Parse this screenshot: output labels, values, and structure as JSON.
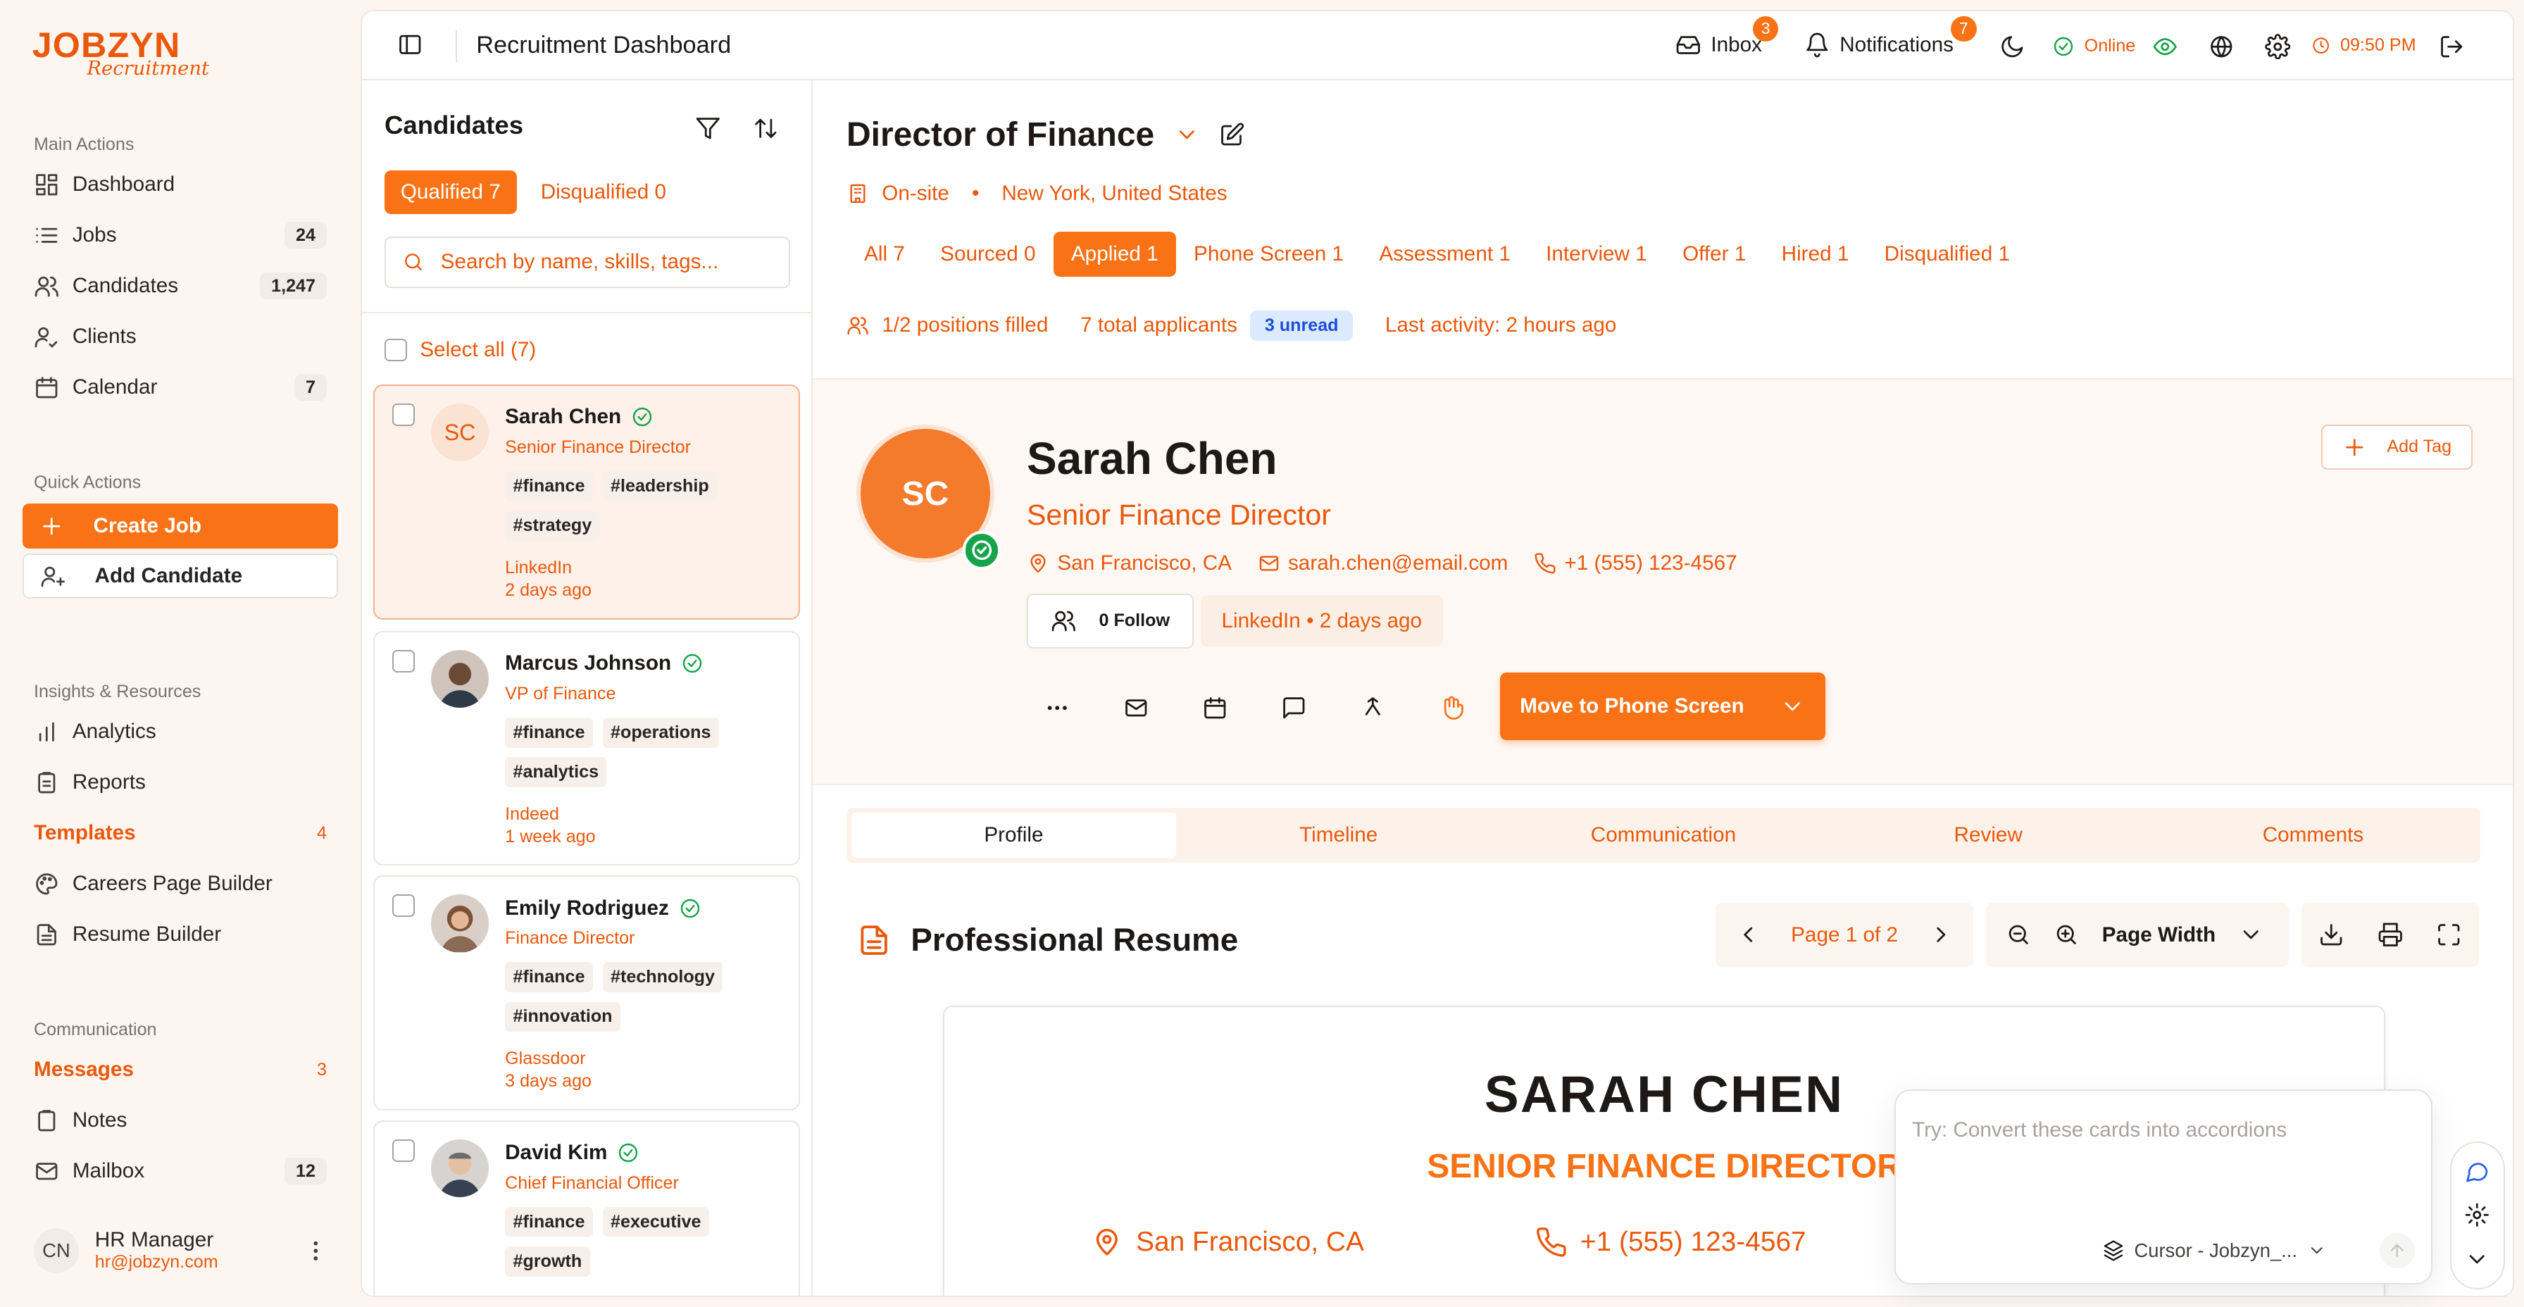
{
  "brand": {
    "name": "JOBZYN",
    "sub": "Recruitment"
  },
  "sidebar": {
    "main_title": "Main Actions",
    "main_items": [
      {
        "label": "Dashboard",
        "badge": "",
        "icon": "grid-icon"
      },
      {
        "label": "Jobs",
        "badge": "24",
        "icon": "list-icon"
      },
      {
        "label": "Candidates",
        "badge": "1,247",
        "icon": "users-icon"
      },
      {
        "label": "Clients",
        "badge": "",
        "icon": "user-check-icon"
      },
      {
        "label": "Calendar",
        "badge": "7",
        "icon": "calendar-icon"
      }
    ],
    "quick_title": "Quick Actions",
    "create_job": "Create Job",
    "add_candidate": "Add Candidate",
    "insights_title": "Insights & Resources",
    "insights_items": [
      {
        "label": "Analytics"
      },
      {
        "label": "Reports"
      },
      {
        "label": "Templates",
        "count": "4"
      },
      {
        "label": "Careers Page Builder"
      },
      {
        "label": "Resume Builder"
      }
    ],
    "comm_title": "Communication",
    "comm_items": [
      {
        "label": "Messages",
        "count": "3"
      },
      {
        "label": "Notes"
      },
      {
        "label": "Mailbox",
        "badge": "12"
      }
    ],
    "user": {
      "initials": "CN",
      "name": "HR Manager",
      "email": "hr@jobzyn.com"
    }
  },
  "topbar": {
    "title": "Recruitment Dashboard",
    "inbox": "Inbox",
    "inbox_count": "3",
    "notifications": "Notifications",
    "notifications_count": "7",
    "status": "Online",
    "time": "09:50 PM"
  },
  "candidates": {
    "title": "Candidates",
    "qualified_tab": "Qualified 7",
    "disqualified_tab": "Disqualified 0",
    "search_placeholder": "Search by name, skills, tags...",
    "select_all": "Select all (7)",
    "list": [
      {
        "initials": "SC",
        "name": "Sarah Chen",
        "role": "Senior Finance Director",
        "tags": [
          "#finance",
          "#leadership",
          "#strategy"
        ],
        "source": "LinkedIn",
        "time": "2 days ago"
      },
      {
        "name": "Marcus Johnson",
        "role": "VP of Finance",
        "tags": [
          "#finance",
          "#operations",
          "#analytics"
        ],
        "source": "Indeed",
        "time": "1 week ago"
      },
      {
        "name": "Emily Rodriguez",
        "role": "Finance Director",
        "tags": [
          "#finance",
          "#technology",
          "#innovation"
        ],
        "source": "Glassdoor",
        "time": "3 days ago"
      },
      {
        "name": "David Kim",
        "role": "Chief Financial Officer",
        "tags": [
          "#finance",
          "#executive",
          "#growth"
        ],
        "source": "",
        "time": ""
      }
    ]
  },
  "job": {
    "title": "Director of Finance",
    "worktype": "On-site",
    "location": "New York, United States",
    "stages": [
      "All 7",
      "Sourced 0",
      "Applied 1",
      "Phone Screen 1",
      "Assessment 1",
      "Interview 1",
      "Offer 1",
      "Hired 1",
      "Disqualified 1"
    ],
    "active_stage": "Applied 1",
    "positions": "1/2 positions filled",
    "applicants": "7 total applicants",
    "unread": "3 unread",
    "last_activity": "Last activity: 2 hours ago"
  },
  "profile": {
    "initials": "SC",
    "name": "Sarah Chen",
    "role": "Senior Finance Director",
    "location": "San Francisco, CA",
    "email": "sarah.chen@email.com",
    "phone": "+1 (555) 123-4567",
    "follow": "0 Follow",
    "source": "LinkedIn • 2 days ago",
    "add_tag": "Add Tag",
    "move_button": "Move to Phone Screen",
    "tabs": [
      "Profile",
      "Timeline",
      "Communication",
      "Review",
      "Comments"
    ]
  },
  "resume": {
    "heading": "Professional Resume",
    "page": "Page 1 of 2",
    "zoom": "Page Width",
    "name": "SARAH CHEN",
    "role": "SENIOR FINANCE DIRECTOR",
    "location": "San Francisco, CA",
    "phone": "+1 (555) 123-4567"
  },
  "assistant": {
    "placeholder": "Try: Convert these cards into accordions",
    "model": "Cursor - Jobzyn_..."
  },
  "colors": {
    "accent": "#f97316",
    "accent_text": "#ea580c",
    "online": "#16a34a",
    "unread_bg": "#dbeafe"
  }
}
